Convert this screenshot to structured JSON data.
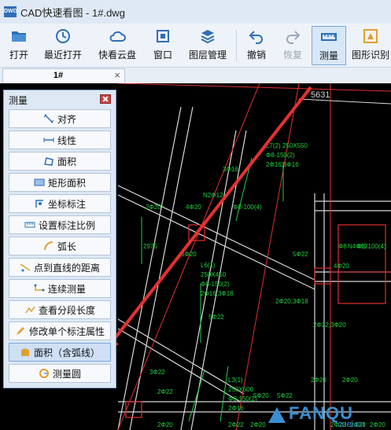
{
  "window": {
    "title": "CAD快速看图 - 1#.dwg",
    "logo_text": "DWG"
  },
  "toolbar": {
    "open": "打开",
    "recent": "最近打开",
    "cloud": "快看云盘",
    "window": "窗口",
    "layers": "图层管理",
    "undo": "撤销",
    "redo": "恢复",
    "measure": "测量",
    "recognize": "图形识别"
  },
  "tab": {
    "label": "1#",
    "close": "×"
  },
  "panel": {
    "title": "测量",
    "items": [
      {
        "label": "对齐",
        "icon": "align-icon"
      },
      {
        "label": "线性",
        "icon": "linear-icon"
      },
      {
        "label": "面积",
        "icon": "area-icon"
      },
      {
        "label": "矩形面积",
        "icon": "rect-area-icon"
      },
      {
        "label": "坐标标注",
        "icon": "coordinate-icon"
      },
      {
        "label": "设置标注比例",
        "icon": "scale-icon"
      },
      {
        "label": "弧长",
        "icon": "arc-icon"
      },
      {
        "label": "点到直线的距离",
        "icon": "point-line-icon"
      },
      {
        "label": "连续测量",
        "icon": "continuous-icon"
      },
      {
        "label": "查看分段长度",
        "icon": "segment-icon"
      },
      {
        "label": "修改单个标注属性",
        "icon": "edit-dim-icon"
      },
      {
        "label": "面积（含弧线）",
        "icon": "arc-area-icon"
      },
      {
        "label": "测量圆",
        "icon": "circle-icon"
      }
    ]
  },
  "drawing": {
    "labels": [
      "5631",
      "L7(2) 250X550",
      "Φ8-150(2)",
      "2Φ16;3Φ16",
      "3Φ16",
      "2Φ20",
      "N2Φ12",
      "Φ8-100(4)",
      "4Φ20",
      "2975",
      "6Φ20",
      "L6(1)",
      "250X450",
      "Φ8-150(2)",
      "2Φ16;3Φ18",
      "2Φ20;3Φ18",
      "5Φ22",
      "2Φ22;3Φ20",
      "Φ8",
      "N4Φ12",
      "Φ8-100(4)",
      "4Φ20",
      "2Φ20",
      "2Φ20",
      "5Φ22",
      "3Φ22",
      "2Φ22",
      "L3(1)",
      "250X600",
      "Φ8-150(2)",
      "2Φ16",
      "5Φ20",
      "5Φ22",
      "2Φ22",
      "2Φ20",
      "2Φ20",
      "2Φ22",
      "2Φ20",
      "2Φ20"
    ]
  },
  "watermark": {
    "brand": "FANQU",
    "site": "cuei.cn"
  }
}
